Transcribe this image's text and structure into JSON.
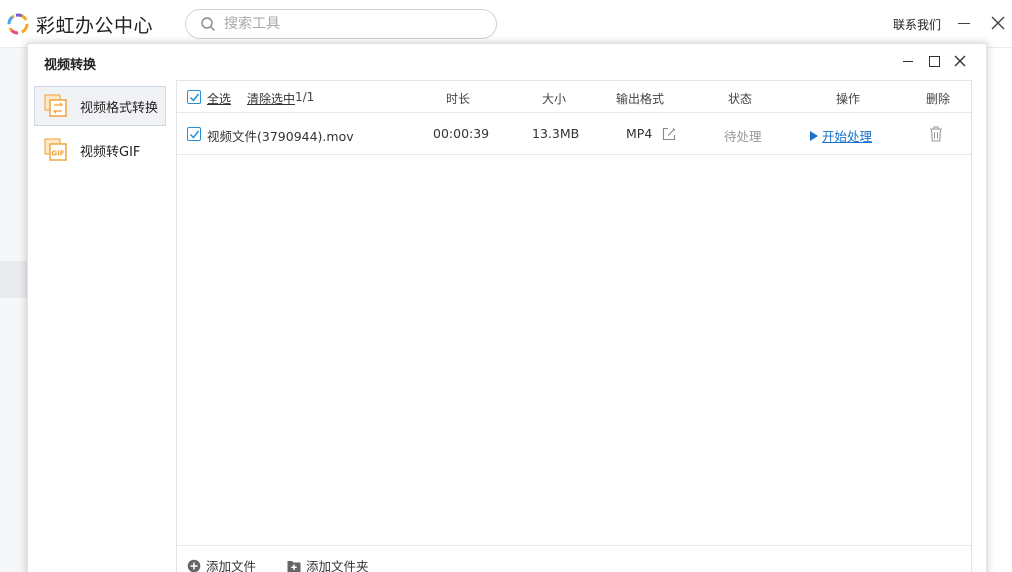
{
  "app": {
    "title": "彩虹办公中心",
    "search_placeholder": "搜索工具",
    "contact_label": "联系我们"
  },
  "dialog": {
    "title": "视频转换",
    "sidebar": [
      {
        "label": "视频格式转换",
        "active": true,
        "icon": "video-convert-icon"
      },
      {
        "label": "视频转GIF",
        "active": false,
        "icon": "gif-icon"
      }
    ],
    "table": {
      "select_all_label": "全选",
      "clear_selection_label": "清除选中",
      "selection_count": "1/1",
      "columns": {
        "duration": "时长",
        "size": "大小",
        "output_format": "输出格式",
        "status": "状态",
        "action": "操作",
        "delete": "删除"
      },
      "rows": [
        {
          "name": "视频文件(3790944).mov",
          "duration": "00:00:39",
          "size": "13.3MB",
          "format": "MP4",
          "status": "待处理",
          "action": "开始处理",
          "checked": true
        }
      ]
    },
    "footer": {
      "add_file_label": "添加文件",
      "add_folder_label": "添加文件夹"
    }
  },
  "colors": {
    "accent_blue": "#1a73c8",
    "checkbox_blue": "#2b8fd8",
    "icon_orange": "#f0a032"
  }
}
